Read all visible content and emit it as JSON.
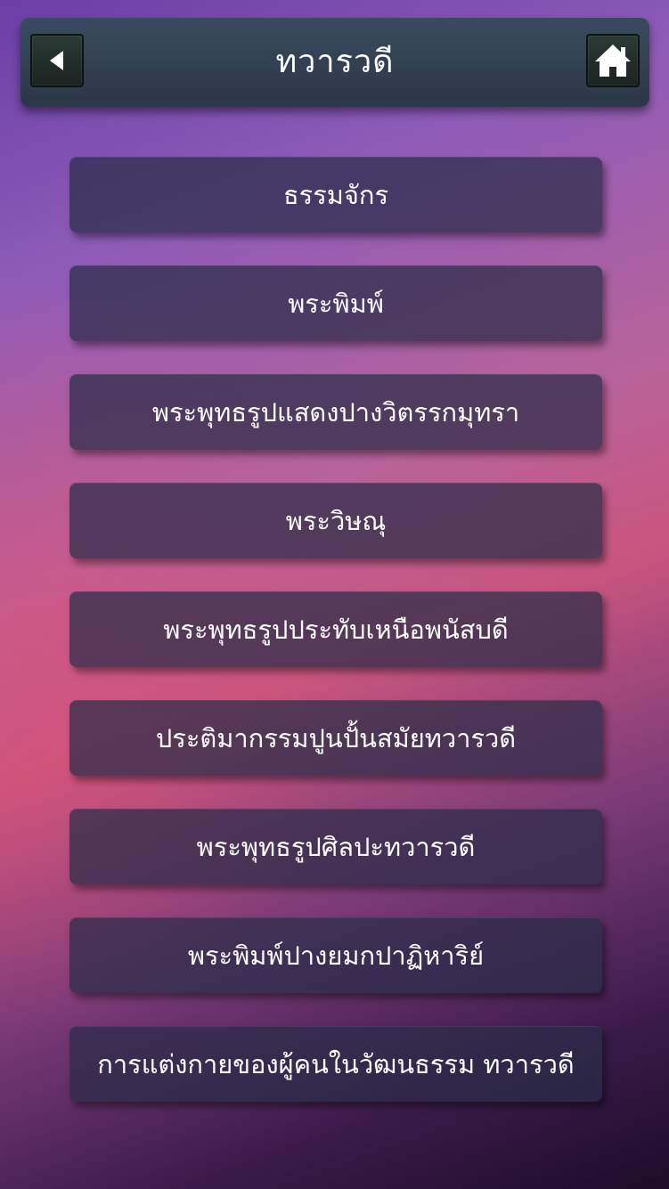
{
  "header": {
    "title": "ทวารวดี",
    "back_icon": "back-arrow-icon",
    "home_icon": "home-icon"
  },
  "menu": {
    "items": [
      {
        "label": "ธรรมจักร"
      },
      {
        "label": "พระพิมพ์"
      },
      {
        "label": "พระพุทธรูปแสดงปางวิตรรกมุทรา"
      },
      {
        "label": "พระวิษณุ"
      },
      {
        "label": "พระพุทธรูปประทับเหนือพนัสบดี"
      },
      {
        "label": "ประติมากรรมปูนปั้นสมัยทวารวดี"
      },
      {
        "label": "พระพุทธรูปศิลปะทวารวดี"
      },
      {
        "label": "พระพิมพ์ปางยมกปาฏิหาริย์"
      },
      {
        "label": "การแต่งกายของผู้คนในวัฒนธรรม ทวารวดี"
      }
    ]
  }
}
